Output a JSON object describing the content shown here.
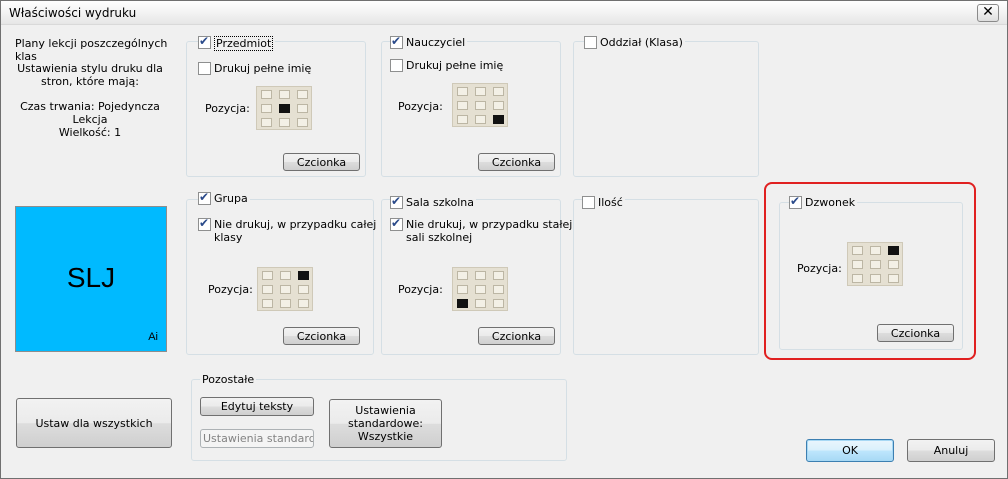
{
  "window": {
    "title": "Właściwości wydruku",
    "close_glyph": "✕"
  },
  "left": {
    "heading": "Plany lekcji poszczególnych klas",
    "style_line1": "Ustawienia stylu druku dla",
    "style_line2": "stron, które mają:",
    "duration_line1": "Czas trwania: Pojedyncza",
    "duration_line2": "Lekcja",
    "size": "Wielkość: 1",
    "preview_main": "SLJ",
    "preview_corner": "Ai",
    "preview_color": "#00baff",
    "set_all_button": "Ustaw dla wszystkich"
  },
  "position_label": "Pozycja:",
  "font_button": "Czcionka",
  "panels": {
    "przedmiot": {
      "label": "Przedmiot",
      "checked": true,
      "sub_label": "Drukuj pełne imię",
      "sub_checked": false,
      "grid_on": 4
    },
    "nauczyciel": {
      "label": "Nauczyciel",
      "checked": true,
      "sub_label": "Drukuj pełne imię",
      "sub_checked": false,
      "grid_on": 8
    },
    "oddzial": {
      "label": "Oddział (Klasa)",
      "checked": false
    },
    "grupa": {
      "label": "Grupa",
      "checked": true,
      "sub_label1": "Nie drukuj, w przypadku całej",
      "sub_label2": "klasy",
      "sub_checked": true,
      "grid_on": 2
    },
    "sala": {
      "label": "Sala szkolna",
      "checked": true,
      "sub_label1": "Nie drukuj, w przypadku stałej",
      "sub_label2": "sali szkolnej",
      "sub_checked": true,
      "grid_on": 6
    },
    "ilosc": {
      "label": "Ilość",
      "checked": false
    },
    "dzwonek": {
      "label": "Dzwonek",
      "checked": true,
      "grid_on": 2
    }
  },
  "pozostale": {
    "title": "Pozostałe",
    "edit_texts_button": "Edytuj teksty",
    "standard_settings_disabled": "Ustawienia standardowe",
    "standard_all_line1": "Ustawienia",
    "standard_all_line2": "standardowe:",
    "standard_all_line3": "Wszystkie"
  },
  "footer": {
    "ok": "OK",
    "cancel": "Anuluj"
  },
  "colors": {
    "highlight": "#e02020",
    "grid_bg": "#e5e0d2",
    "grid_active": "#111111"
  }
}
